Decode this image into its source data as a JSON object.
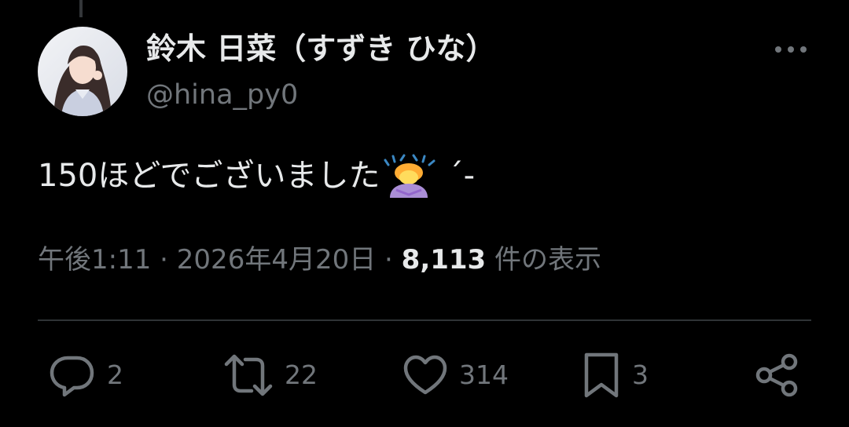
{
  "author": {
    "display_name": "鈴木 日菜（すずき ひな）",
    "handle": "@hina_py0",
    "avatar_icon": "profile-photo"
  },
  "tweet": {
    "text": "150ほどでございました",
    "emoji": "person-bowing-emoji",
    "emoji_tail": "´-"
  },
  "meta": {
    "time": "午後1:11",
    "separator": "·",
    "date": "2026年4月20日",
    "views_count": "8,113",
    "views_label": "件の表示"
  },
  "actions": {
    "reply_count": "2",
    "retweet_count": "22",
    "like_count": "314",
    "bookmark_count": "3"
  },
  "colors": {
    "background": "#000000",
    "text": "#e7e9ea",
    "secondary": "#71767b",
    "divider": "#2f3336"
  }
}
